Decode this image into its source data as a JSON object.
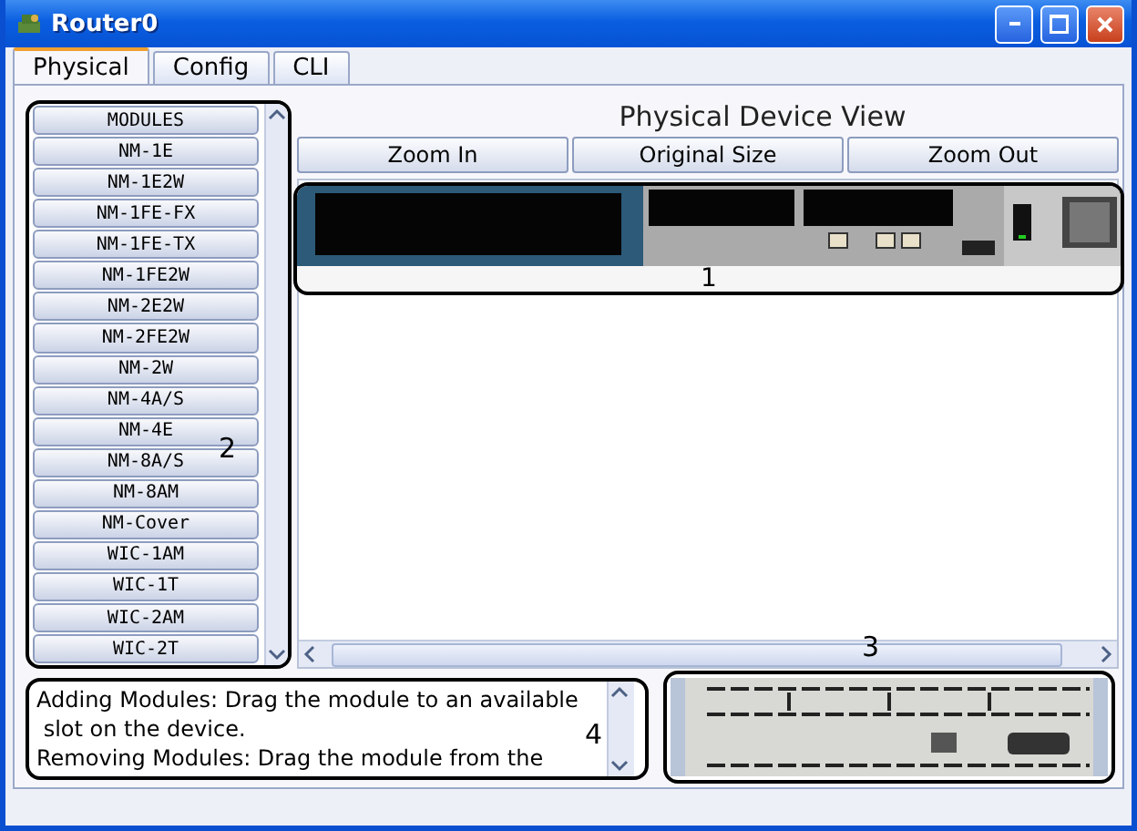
{
  "window": {
    "title": "Router0"
  },
  "tabs": [
    {
      "label": "Physical",
      "selected": true
    },
    {
      "label": "Config",
      "selected": false
    },
    {
      "label": "CLI",
      "selected": false
    }
  ],
  "modules": {
    "header": "MODULES",
    "items": [
      "NM-1E",
      "NM-1E2W",
      "NM-1FE-FX",
      "NM-1FE-TX",
      "NM-1FE2W",
      "NM-2E2W",
      "NM-2FE2W",
      "NM-2W",
      "NM-4A/S",
      "NM-4E",
      "NM-8A/S",
      "NM-8AM",
      "NM-Cover",
      "WIC-1AM",
      "WIC-1T",
      "WIC-2AM",
      "WIC-2T"
    ]
  },
  "device_view": {
    "title": "Physical Device View",
    "buttons": [
      "Zoom In",
      "Original Size",
      "Zoom Out"
    ]
  },
  "info_text": [
    "Adding Modules: Drag the module to an available",
    " slot on the device.",
    "Removing Modules: Drag the module from the"
  ],
  "annotations": {
    "device": "1",
    "modules": "2",
    "scrollbar": "3",
    "info": "4"
  }
}
